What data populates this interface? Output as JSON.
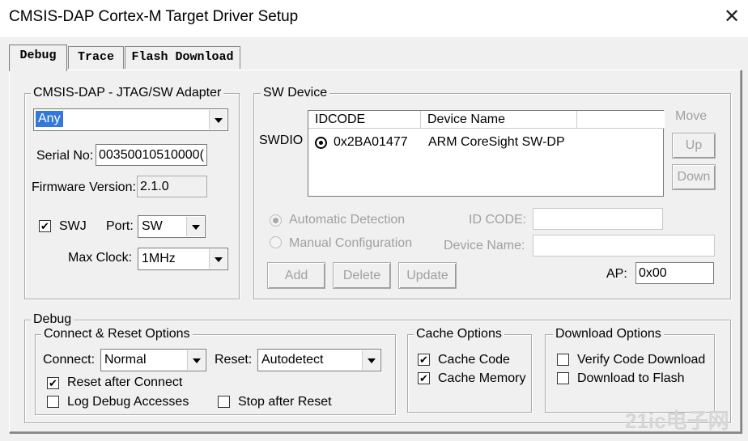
{
  "window": {
    "title": "CMSIS-DAP Cortex-M Target Driver Setup"
  },
  "tabs": [
    {
      "label": "Debug"
    },
    {
      "label": "Trace"
    },
    {
      "label": "Flash Download"
    }
  ],
  "adapter": {
    "group_label": "CMSIS-DAP - JTAG/SW Adapter",
    "selected": "Any",
    "serial_label": "Serial No:",
    "serial_value": "00350010510000(",
    "firmware_label": "Firmware Version:",
    "firmware_value": "2.1.0",
    "swj_label": "SWJ",
    "swj_checked": true,
    "port_label": "Port:",
    "port_value": "SW",
    "maxclock_label": "Max Clock:",
    "maxclock_value": "1MHz"
  },
  "sw_device": {
    "group_label": "SW Device",
    "swdio_label": "SWDIO",
    "columns": [
      "IDCODE",
      "Device Name"
    ],
    "rows": [
      {
        "idcode": "0x2BA01477",
        "device_name": "ARM CoreSight SW-DP"
      }
    ],
    "move_label": "Move",
    "up_label": "Up",
    "down_label": "Down",
    "auto_detect_label": "Automatic Detection",
    "manual_config_label": "Manual Configuration",
    "id_code_label": "ID CODE:",
    "device_name_label": "Device Name:",
    "add_label": "Add",
    "delete_label": "Delete",
    "update_label": "Update",
    "ap_label": "AP:",
    "ap_value": "0x00"
  },
  "debug": {
    "group_label": "Debug",
    "connect_reset": {
      "group_label": "Connect & Reset Options",
      "connect_label": "Connect:",
      "connect_value": "Normal",
      "reset_label": "Reset:",
      "reset_value": "Autodetect",
      "reset_after_connect_label": "Reset after Connect",
      "reset_after_connect_checked": true,
      "log_debug_label": "Log Debug Accesses",
      "log_debug_checked": false,
      "stop_after_reset_label": "Stop after Reset",
      "stop_after_reset_checked": false
    },
    "cache": {
      "group_label": "Cache Options",
      "cache_code_label": "Cache Code",
      "cache_code_checked": true,
      "cache_memory_label": "Cache Memory",
      "cache_memory_checked": true
    },
    "download": {
      "group_label": "Download Options",
      "verify_label": "Verify Code Download",
      "verify_checked": false,
      "flash_label": "Download to Flash",
      "flash_checked": false
    }
  },
  "watermark": {
    "text": "21ic电子网"
  }
}
